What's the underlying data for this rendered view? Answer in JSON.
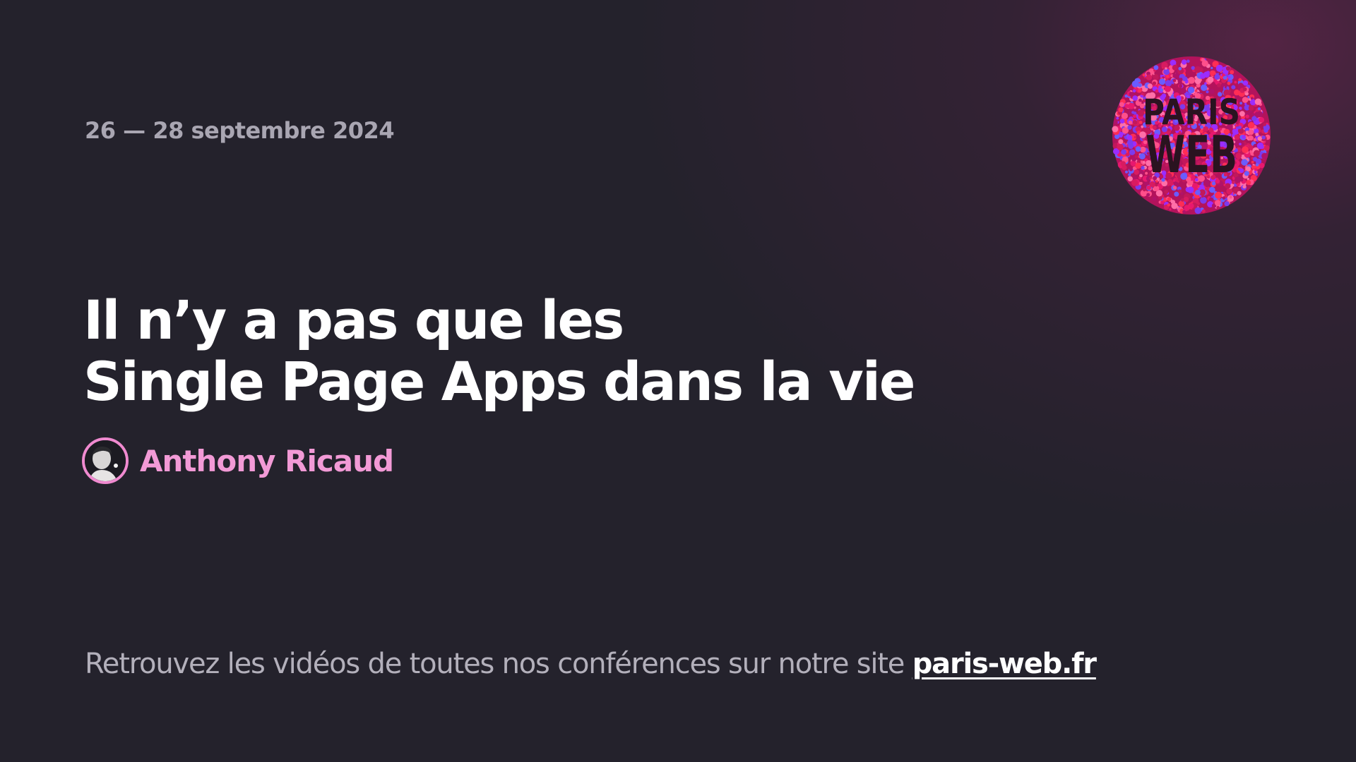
{
  "event": {
    "dates": "26 — 28 septembre 2024"
  },
  "logo": {
    "line1": "PARIS",
    "line2": "WEB",
    "colors": [
      "#e8186e",
      "#c2185b",
      "#ff4f8b",
      "#9b2cff",
      "#6a5cff",
      "#ff2d55",
      "#d81b60",
      "#b0126a",
      "#ff6fa8",
      "#7c3aed"
    ]
  },
  "talk": {
    "title_line1": "Il n’y a pas que les",
    "title_line2": "Single Page Apps dans la vie"
  },
  "speaker": {
    "name": "Anthony Ricaud"
  },
  "footer": {
    "text": "Retrouvez les vidéos de toutes nos conférences sur notre site ",
    "link_label": "paris-web.fr"
  },
  "theme": {
    "background": "#24222c",
    "accent": "#f29ad6",
    "muted": "#a9a6b2"
  }
}
